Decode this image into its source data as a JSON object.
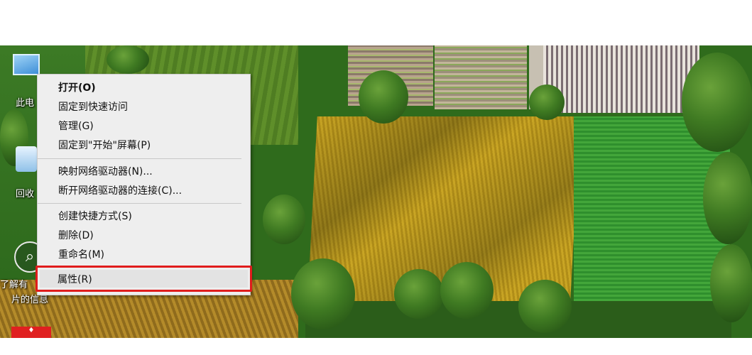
{
  "desktop": {
    "icons": [
      {
        "name": "this-pc",
        "label": "此电"
      },
      {
        "name": "recycle-bin",
        "label": "回收"
      },
      {
        "name": "learn-about-picture",
        "label_line1": "了解有",
        "label_line2": "片的信息"
      }
    ]
  },
  "context_menu": {
    "items": [
      {
        "label": "打开(O)",
        "bold": true
      },
      {
        "label": "固定到快速访问"
      },
      {
        "label": "管理(G)"
      },
      {
        "label": "固定到\"开始\"屏幕(P)"
      },
      {
        "label": "映射网络驱动器(N)..."
      },
      {
        "label": "断开网络驱动器的连接(C)..."
      },
      {
        "label": "创建快捷方式(S)"
      },
      {
        "label": "删除(D)"
      },
      {
        "label": "重命名(M)"
      },
      {
        "label": "属性(R)"
      }
    ]
  },
  "colors": {
    "highlight_border": "#e01c1c",
    "menu_background": "#eeeeee"
  }
}
